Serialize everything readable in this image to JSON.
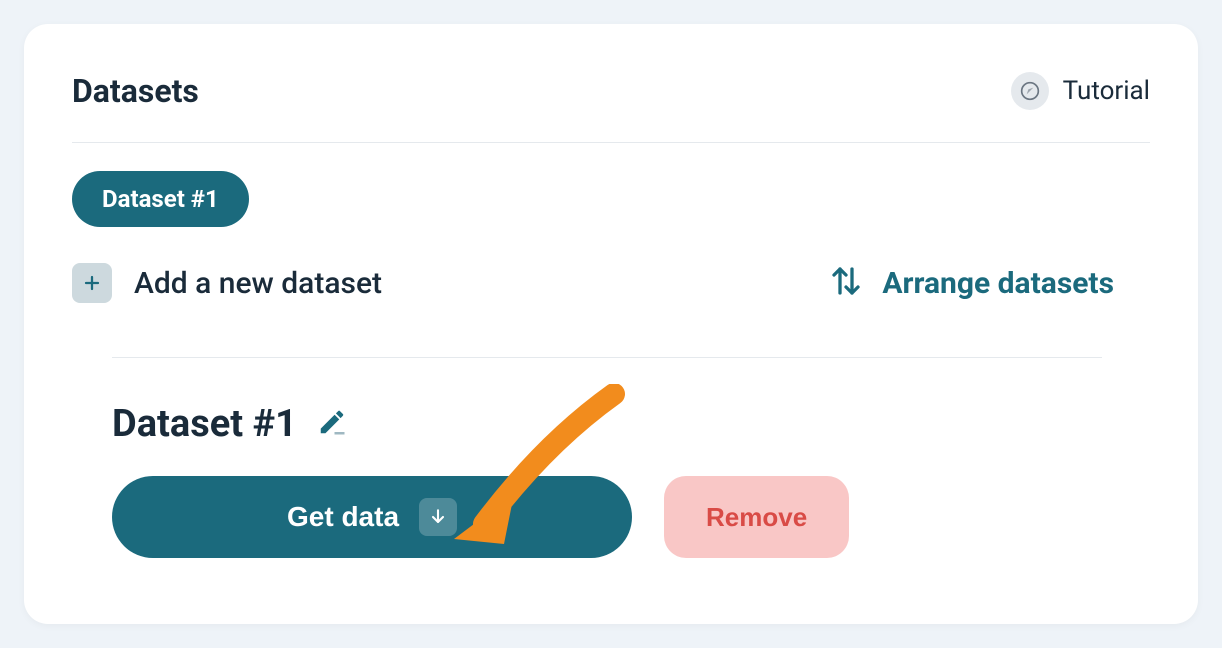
{
  "header": {
    "title": "Datasets",
    "tutorial_label": "Tutorial"
  },
  "tabs": {
    "active": "Dataset #1"
  },
  "actions": {
    "add_label": "Add a new dataset",
    "arrange_label": "Arrange datasets"
  },
  "detail": {
    "title": "Dataset #1",
    "get_data_label": "Get data",
    "remove_label": "Remove"
  },
  "colors": {
    "accent": "#1b6a7d",
    "danger_bg": "#f9c7c6",
    "danger_text": "#d94b46",
    "arrow": "#f28c1d"
  }
}
